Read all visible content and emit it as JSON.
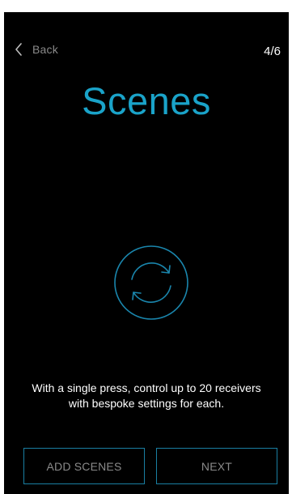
{
  "header": {
    "back_label": "Back",
    "step_counter": "4/6"
  },
  "main": {
    "title": "Scenes",
    "icon": "sync-cycle-icon",
    "description": "With a single press, control up to 20 receivers with bespoke settings for each."
  },
  "actions": {
    "add_scenes_label": "ADD SCENES",
    "next_label": "NEXT"
  },
  "colors": {
    "background": "#000000",
    "accent": "#1aa3c9",
    "muted_text": "#8a8a8a",
    "text": "#ffffff"
  }
}
